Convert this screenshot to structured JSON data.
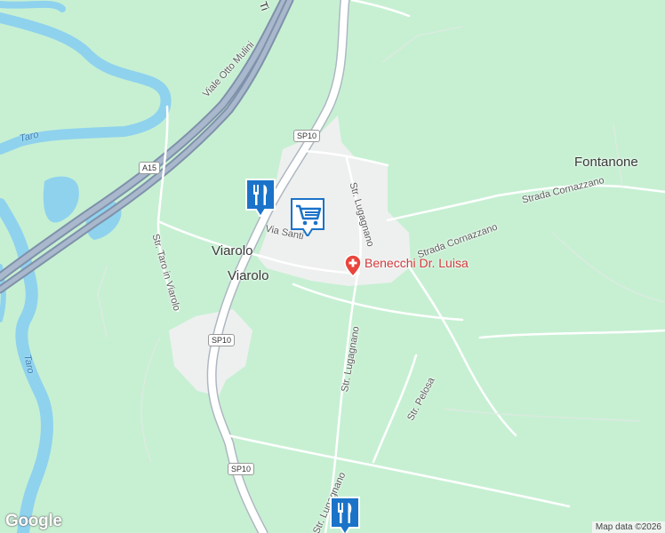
{
  "places": {
    "fontanone": "Fontanone",
    "viarolo_1": "Viarolo",
    "viarolo_2": "Viarolo"
  },
  "roads": {
    "viale_otto_mulini": "Viale Otto Mulini",
    "via_santi": "Via Santi",
    "str_taro_in_viarolo": "Str. Taro in Viarolo",
    "str_lugagnano_north": "Str. Lugagnano",
    "str_lugagnano_south": "Str. Lugagnano",
    "str_lugagnano_bottom": "Str. Lugagnano",
    "strada_cornazzano_1": "Strada Cornazzano",
    "strada_cornazzano_2": "Strada Cornazzano",
    "str_pelosa": "Str. Pelosa",
    "ti_partial": "Ti"
  },
  "water": {
    "taro_1": "Taro",
    "taro_2": "Taro"
  },
  "shields": {
    "a15": "A15",
    "sp10_north": "SP10",
    "sp10_mid": "SP10",
    "sp10_south": "SP10"
  },
  "pois": {
    "restaurant_1": "restaurant-icon",
    "shop": "shopping-cart-icon",
    "restaurant_2": "restaurant-icon",
    "doctor": "Benecchi Dr. Luisa"
  },
  "footer": {
    "logo": "Google",
    "attribution": "Map data ©2026"
  },
  "colors": {
    "land": "#c7f0d3",
    "water": "#8fd2ee",
    "urban": "#eef0ef",
    "highway": "#8e9fb6",
    "road": "#ffffff",
    "poi_blue": "#1a73c8",
    "hospital_red": "#e8453c"
  }
}
